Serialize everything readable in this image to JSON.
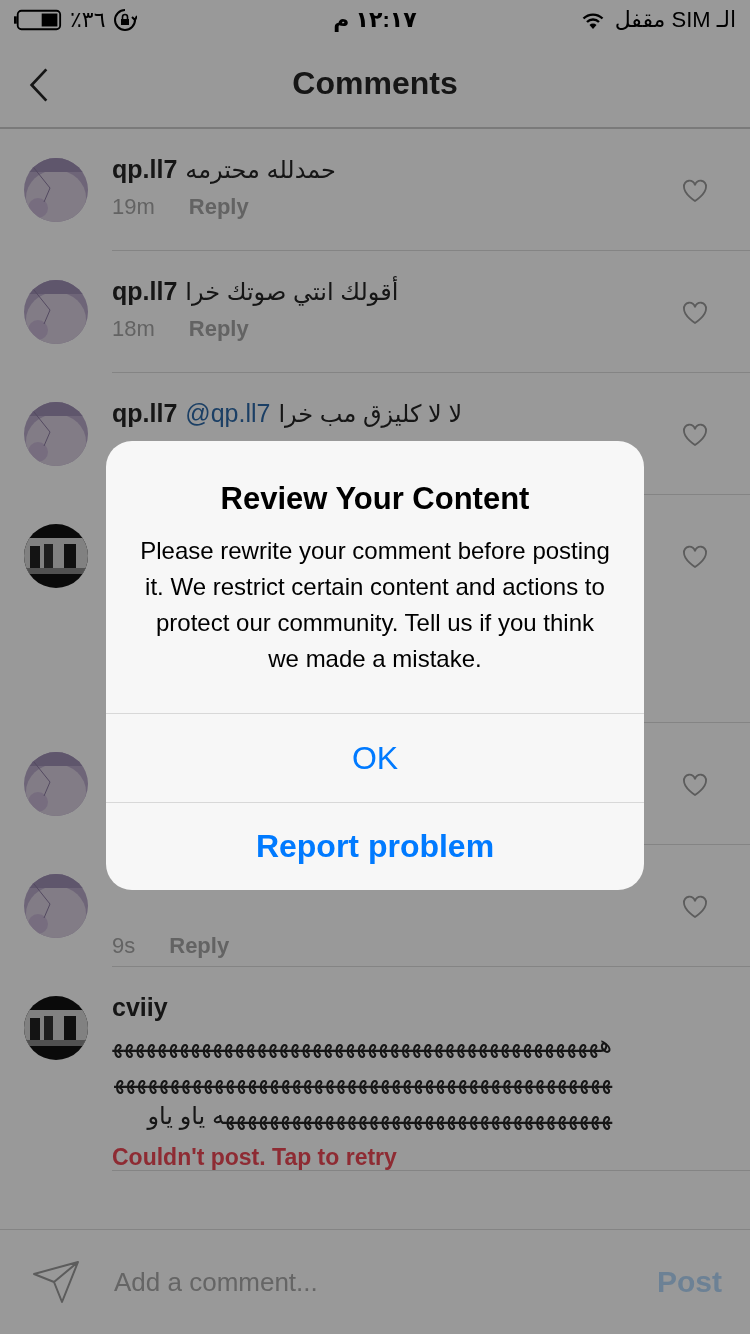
{
  "status_bar": {
    "battery": "٪٣٦",
    "time": "١٢:١٧ م",
    "carrier": "الـ SIM مقفل"
  },
  "nav": {
    "title": "Comments"
  },
  "comments": [
    {
      "user": "qp.ll7",
      "text": "حمدلله محترمه",
      "time": "19m",
      "reply": "Reply",
      "liked": false
    },
    {
      "user": "qp.ll7",
      "text": "أقولك انتي صوتك خرا",
      "time": "18m",
      "reply": "Reply",
      "liked": false
    },
    {
      "user": "qp.ll7",
      "mention": "@qp.ll7",
      "text": "لا لا كليزق مب خرا",
      "liked": false
    },
    {
      "liked": false
    },
    {
      "liked": false
    },
    {
      "time": "9s",
      "reply": "Reply",
      "liked": false
    },
    {
      "user": "cviiy",
      "text": "هههههههههههههههههههههههههههههههههههههههههههههههههههههههههههههههههههههههههههههههههههههههههههههههههههههههههههههههههههههههههههههه ياو ياو",
      "error": "Couldn't post. Tap to retry"
    }
  ],
  "composer": {
    "placeholder": "Add a comment...",
    "post": {
      "label": "Post",
      "disabled": true
    }
  },
  "dialog": {
    "title": "Review Your Content",
    "message": "Please rewrite your comment before posting it. We restrict certain content and actions to protect our community. Tell us if you think we made a mistake.",
    "buttons": [
      {
        "label": "OK",
        "kind": "default"
      },
      {
        "label": "Report problem",
        "kind": "bold"
      }
    ]
  }
}
